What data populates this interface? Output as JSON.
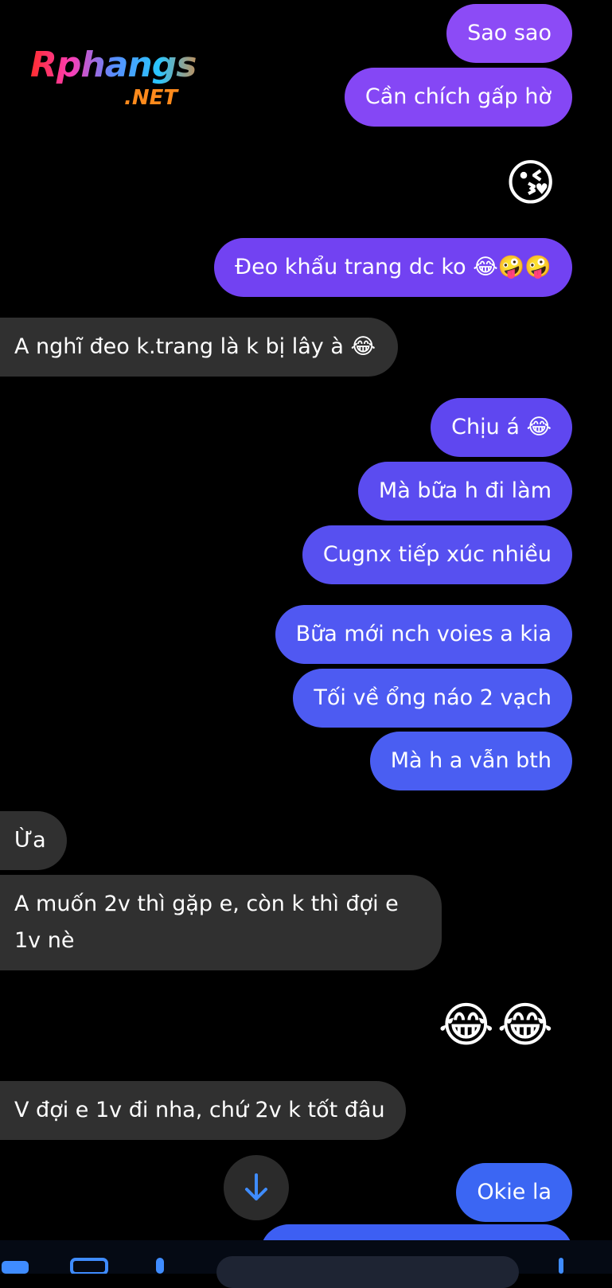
{
  "watermark": {
    "top": "Rphangs",
    "bottom": ".NET"
  },
  "messages": [
    {
      "dir": "out",
      "text": "Sao sao",
      "color": "#8c4bf6"
    },
    {
      "dir": "out",
      "text": "Cần chích gấp hờ",
      "color": "#8547f5"
    },
    {
      "dir": "out",
      "text": "😘",
      "emoji_only": true
    },
    {
      "dir": "out",
      "text": "Đeo khẩu trang dc ko 😂🤪🤪",
      "color": "#7242f2"
    },
    {
      "dir": "in",
      "text": "A nghĩ đeo k.trang là k bị lây à 😂",
      "color": "#303030"
    },
    {
      "dir": "out",
      "text": "Chịu á 😂",
      "color": "#5f47f0"
    },
    {
      "dir": "out",
      "text": "Mà bữa h đi làm",
      "color": "#5b4cf0"
    },
    {
      "dir": "out",
      "text": "Cugnx tiếp xúc nhiều",
      "color": "#5750f0"
    },
    {
      "dir": "out",
      "text": "Bữa mới nch voies a kia",
      "color": "#5058f2"
    },
    {
      "dir": "out",
      "text": "Tối về ổng náo 2 vạch",
      "color": "#4d5bf2"
    },
    {
      "dir": "out",
      "text": "Mà h a vẫn bth",
      "color": "#4a5ef2"
    },
    {
      "dir": "in",
      "text": "Ừa",
      "color": "#303030"
    },
    {
      "dir": "in",
      "text": "A muốn 2v thì gặp e, còn k thì đợi e 1v nè",
      "color": "#303030"
    },
    {
      "dir": "out",
      "text": "😂😂",
      "emoji_only": true
    },
    {
      "dir": "in",
      "text": "V đợi e 1v đi nha, chứ 2v k tốt đâu",
      "color": "#303030"
    },
    {
      "dir": "out",
      "text": "Okie la",
      "color": "#3b66f3"
    }
  ],
  "scroll_button": {
    "icon": "arrow-down-icon",
    "color": "#3f8cff"
  },
  "accent_color": "#3f8cff"
}
